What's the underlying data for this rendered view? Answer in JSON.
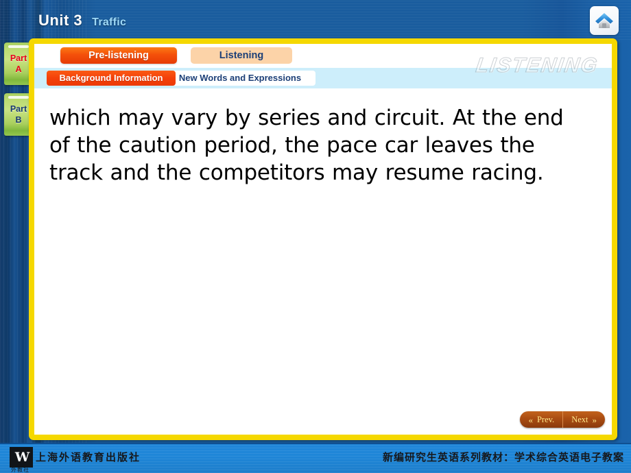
{
  "header": {
    "unit": "Unit 3",
    "topic": "Traffic",
    "home_icon": "home-icon"
  },
  "sidebar": {
    "items": [
      {
        "line1": "Part",
        "line2": "A",
        "active": true
      },
      {
        "line1": "Part",
        "line2": "B",
        "active": false
      }
    ]
  },
  "main": {
    "watermark": "LISTENING",
    "tabs": [
      {
        "label": "Pre-listening",
        "active": true
      },
      {
        "label": "Listening",
        "active": false
      }
    ],
    "subtabs": [
      {
        "label": "Background Information",
        "active": true
      },
      {
        "label": "New Words and Expressions",
        "active": false
      }
    ],
    "body_text": "which may vary by series and circuit. At the end of the caution period, the pace car leaves the track and the competitors may resume racing."
  },
  "nav": {
    "prev_label": "Prev.",
    "next_label": "Next",
    "prev_icon": "chevron-double-left-icon",
    "next_icon": "chevron-double-right-icon"
  },
  "footer": {
    "logo_mark": "W",
    "logo_sub": "外教社",
    "publisher": "上海外语教育出版社",
    "series_title": "新编研究生英语系列教材：学术综合英语电子教案"
  },
  "colors": {
    "accent_orange": "#f4500a",
    "frame_yellow": "#f5d800",
    "panel_blue": "#cdeefb",
    "bg_blue": "#1a5d9e"
  }
}
